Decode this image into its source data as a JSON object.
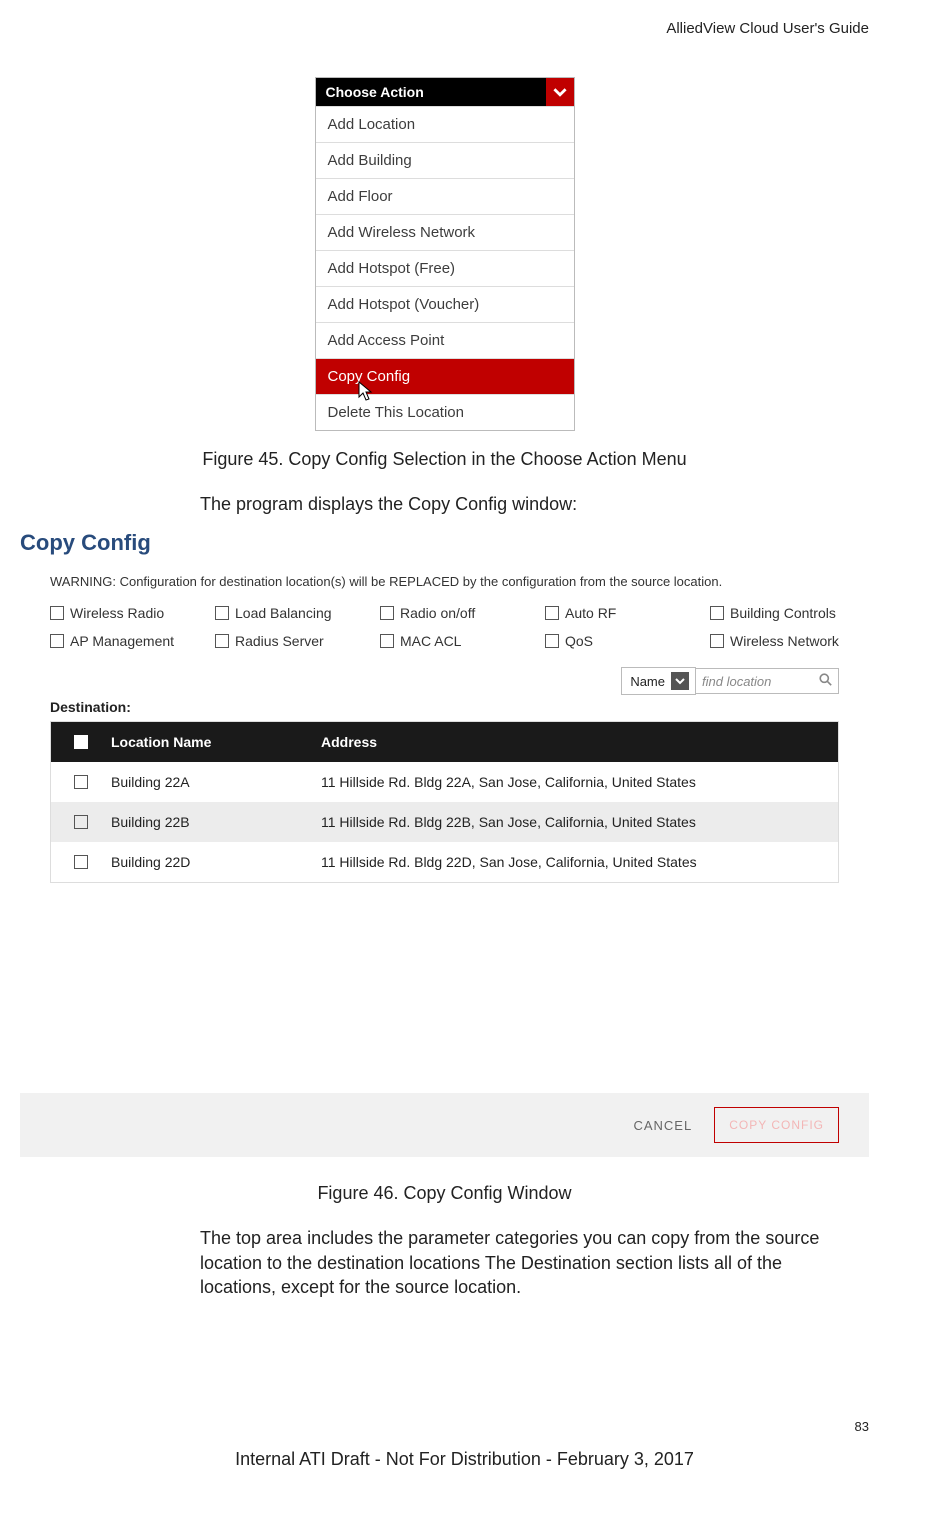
{
  "doc": {
    "header": "AlliedView Cloud User's Guide",
    "page_number": "83",
    "footer": "Internal ATI Draft - Not For Distribution - February 3, 2017"
  },
  "dropdown": {
    "title": "Choose Action",
    "items": [
      "Add Location",
      "Add Building",
      "Add Floor",
      "Add Wireless Network",
      "Add Hotspot (Free)",
      "Add Hotspot (Voucher)",
      "Add Access Point",
      "Copy Config",
      "Delete This Location"
    ],
    "selected_index": 7
  },
  "captions": {
    "fig45": "Figure 45. Copy Config Selection in the Choose Action Menu",
    "fig46": "Figure 46. Copy Config Window"
  },
  "paras": {
    "p1": "The program displays the Copy Config window:",
    "p2": "The top area includes the parameter categories you can copy from the source location to the destination locations The Destination section lists all of the locations, except for the source location."
  },
  "copyconfig": {
    "title": "Copy Config",
    "warning": "WARNING: Configuration for destination location(s) will be REPLACED by the configuration from the source location.",
    "checks": [
      "Wireless Radio",
      "Load Balancing",
      "Radio on/off",
      "Auto RF",
      "Building Controls",
      "AP Management",
      "Radius Server",
      "MAC ACL",
      "QoS",
      "Wireless Network"
    ],
    "search_selector": "Name",
    "search_placeholder": "find location",
    "destination_label": "Destination:",
    "table": {
      "headers": {
        "name": "Location Name",
        "address": "Address"
      },
      "rows": [
        {
          "name": "Building 22A",
          "address": "11 Hillside Rd. Bldg 22A, San Jose, California, United States"
        },
        {
          "name": "Building 22B",
          "address": "11 Hillside Rd. Bldg 22B, San Jose, California, United States"
        },
        {
          "name": "Building 22D",
          "address": "11 Hillside Rd. Bldg 22D, San Jose, California, United States"
        }
      ]
    },
    "buttons": {
      "cancel": "CANCEL",
      "copy": "COPY CONFIG"
    }
  }
}
